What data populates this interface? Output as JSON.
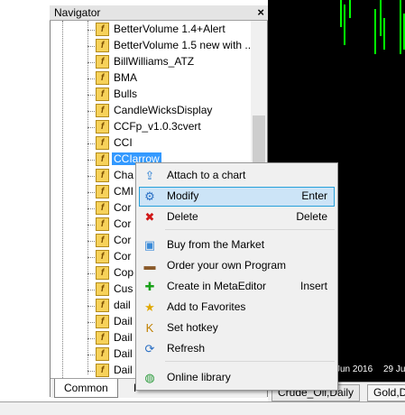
{
  "navigator": {
    "title": "Navigator",
    "close_glyph": "×",
    "items": [
      {
        "label": "BetterVolume 1.4+Alert"
      },
      {
        "label": "BetterVolume 1.5 new with ..."
      },
      {
        "label": "BillWilliams_ATZ"
      },
      {
        "label": "BMA"
      },
      {
        "label": "Bulls"
      },
      {
        "label": "CandleWicksDisplay"
      },
      {
        "label": "CCFp_v1.0.3cvert"
      },
      {
        "label": "CCI"
      },
      {
        "label": "CCIarrow",
        "selected": true
      },
      {
        "label": "Cha"
      },
      {
        "label": "CMI"
      },
      {
        "label": "Cor"
      },
      {
        "label": "Cor"
      },
      {
        "label": "Cor"
      },
      {
        "label": "Cor"
      },
      {
        "label": "Cop"
      },
      {
        "label": "Cus"
      },
      {
        "label": "dail"
      },
      {
        "label": "Dail"
      },
      {
        "label": "Dail"
      },
      {
        "label": "Dail"
      },
      {
        "label": "Dail"
      }
    ],
    "item_icon": "indicator-fx-icon",
    "item_icon_glyph": "f",
    "tabs": [
      {
        "label": "Common",
        "active": true
      },
      {
        "label": "F"
      }
    ]
  },
  "context_menu": {
    "items": [
      {
        "icon": "attach-chart-icon",
        "glyph": "⇪",
        "color": "#2a7fd4",
        "label": "Attach to a chart",
        "shortcut": ""
      },
      {
        "icon": "gear-icon",
        "glyph": "⚙",
        "color": "#2a6fc4",
        "label": "Modify",
        "shortcut": "Enter",
        "highlighted": true
      },
      {
        "icon": "delete-x-icon",
        "glyph": "✖",
        "color": "#d01818",
        "label": "Delete",
        "shortcut": "Delete"
      },
      {
        "icon": "shopping-bag-icon",
        "glyph": "▣",
        "color": "#3a8ad8",
        "label": "Buy from the Market",
        "shortcut": ""
      },
      {
        "icon": "briefcase-icon",
        "glyph": "▬",
        "color": "#8a5a2a",
        "label": "Order your own Program",
        "shortcut": ""
      },
      {
        "icon": "plus-icon",
        "glyph": "✚",
        "color": "#18a018",
        "label": "Create in MetaEditor",
        "shortcut": "Insert"
      },
      {
        "icon": "star-icon",
        "glyph": "★",
        "color": "#e0a800",
        "label": "Add to Favorites",
        "shortcut": ""
      },
      {
        "icon": "hotkey-icon",
        "glyph": "K",
        "color": "#c08000",
        "label": "Set hotkey",
        "shortcut": ""
      },
      {
        "icon": "refresh-icon",
        "glyph": "⟳",
        "color": "#2a6fc4",
        "label": "Refresh",
        "shortcut": ""
      },
      {
        "icon": "globe-icon",
        "glyph": "◍",
        "color": "#2a9a3a",
        "label": "Online library",
        "shortcut": ""
      }
    ]
  },
  "chart": {
    "date_labels": [
      "Jun 2016",
      "29 Ju"
    ],
    "tabs": [
      "Crude_Oil,Daily",
      "Gold,Da"
    ]
  }
}
